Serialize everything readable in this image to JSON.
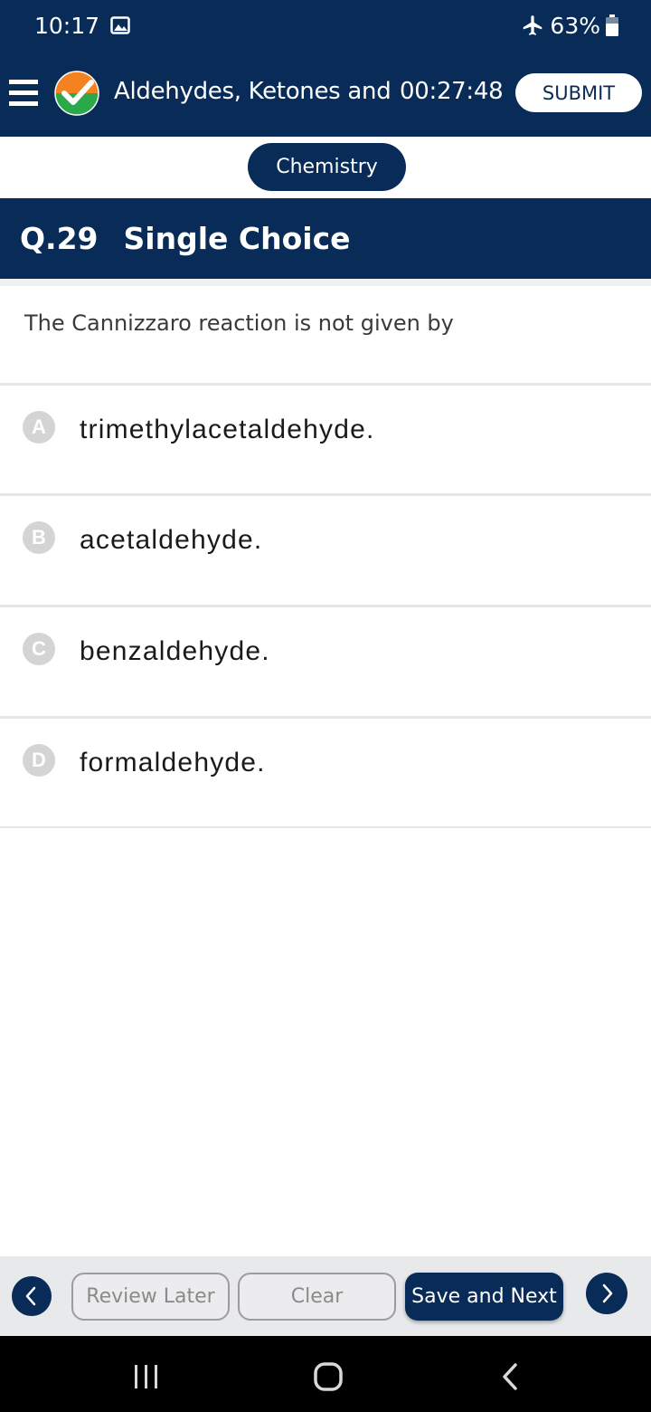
{
  "status_bar": {
    "time": "10:17",
    "battery": "63%"
  },
  "header": {
    "title": "Aldehydes, Ketones and",
    "timer": "00:27:48",
    "submit_label": "SUBMIT"
  },
  "subject": "Chemistry",
  "question": {
    "number": "Q.29",
    "type": "Single Choice",
    "text": "The Cannizzaro reaction is not given by"
  },
  "options": [
    {
      "letter": "A",
      "text": "trimethylacetaldehyde."
    },
    {
      "letter": "B",
      "text": "acetaldehyde."
    },
    {
      "letter": "C",
      "text": "benzaldehyde."
    },
    {
      "letter": "D",
      "text": "formaldehyde."
    }
  ],
  "footer": {
    "review_label": "Review Later",
    "clear_label": "Clear",
    "save_next_label": "Save and Next"
  },
  "colors": {
    "primary": "#082b58",
    "badge": "#d4d4d4"
  },
  "icons": [
    "gallery-icon",
    "airplane-icon",
    "battery-icon",
    "menu-icon",
    "logo-check-icon",
    "chevron-left-icon",
    "chevron-right-icon",
    "recents-icon",
    "home-icon",
    "back-icon"
  ]
}
